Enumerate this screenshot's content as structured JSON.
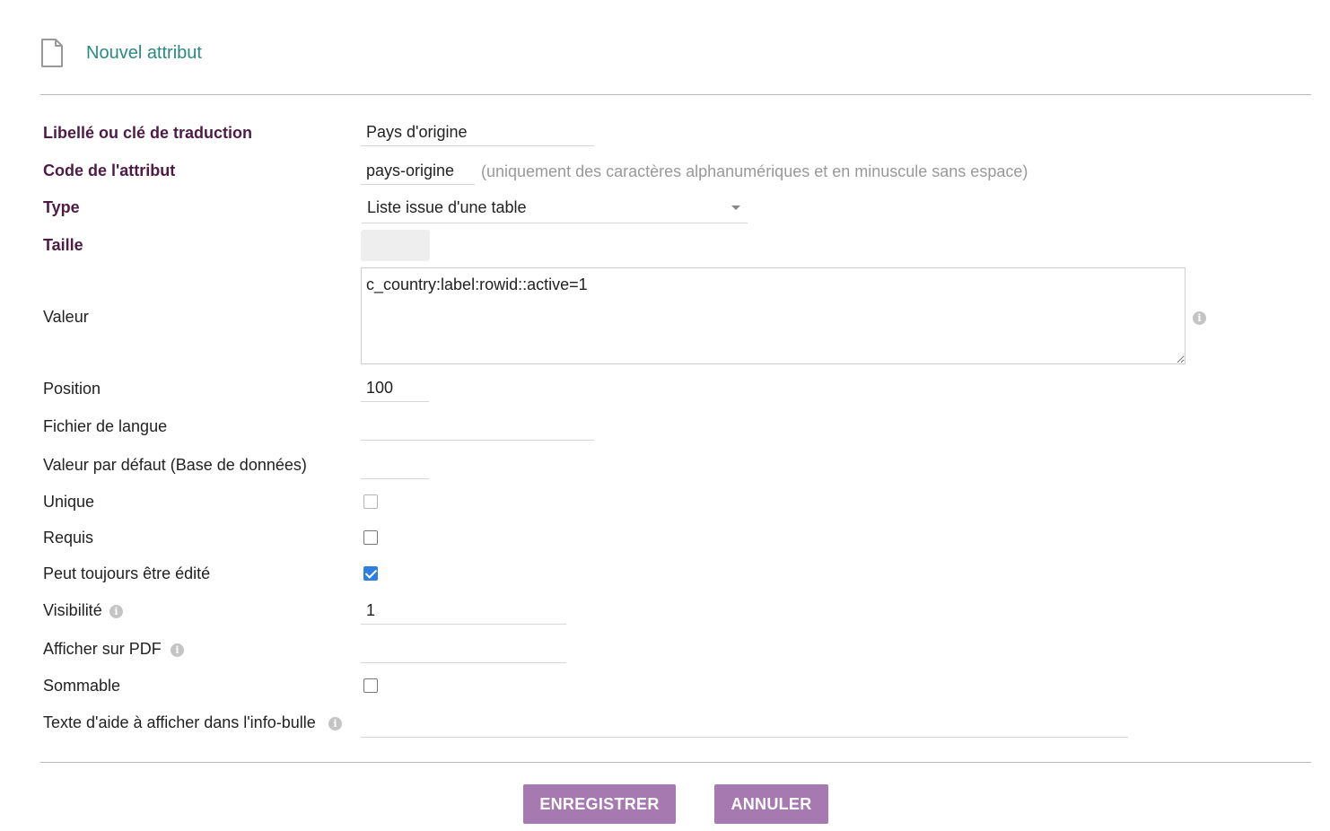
{
  "header": {
    "title": "Nouvel attribut",
    "icon": "file-icon"
  },
  "form": {
    "label": {
      "label": "Libellé ou clé de traduction",
      "value": "Pays d'origine"
    },
    "code": {
      "label": "Code de l'attribut",
      "value": "pays-origine",
      "hint": "(uniquement des caractères alphanumériques et en minuscule sans espace)"
    },
    "type": {
      "label": "Type",
      "selected": "Liste issue d'une table"
    },
    "size": {
      "label": "Taille",
      "value": ""
    },
    "valeur": {
      "label": "Valeur",
      "value": "c_country:label:rowid::active=1"
    },
    "position": {
      "label": "Position",
      "value": "100"
    },
    "langfile": {
      "label": "Fichier de langue",
      "value": ""
    },
    "default": {
      "label": "Valeur par défaut (Base de données)",
      "value": ""
    },
    "unique": {
      "label": "Unique",
      "checked": false
    },
    "required": {
      "label": "Requis",
      "checked": false
    },
    "always_editable": {
      "label": "Peut toujours être édité",
      "checked": true
    },
    "visibility": {
      "label": "Visibilité",
      "value": "1"
    },
    "pdf": {
      "label": "Afficher sur PDF",
      "value": ""
    },
    "totalizable": {
      "label": "Sommable",
      "checked": false
    },
    "help": {
      "label": "Texte d'aide à afficher dans l'info-bulle",
      "value": ""
    }
  },
  "buttons": {
    "save": "ENREGISTRER",
    "cancel": "ANNULER"
  },
  "colors": {
    "title": "#2a8a82",
    "required_label": "#4d1c45",
    "button": "#a679b0",
    "checkbox_checked": "#2f7fe0"
  }
}
